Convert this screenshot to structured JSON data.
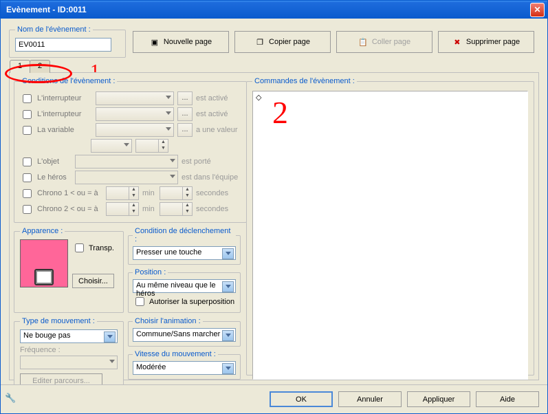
{
  "window": {
    "title": "Evènement - ID:0011"
  },
  "nameSection": {
    "legend": "Nom de l'évènement :",
    "value": "EV0011"
  },
  "topButtons": {
    "new": "Nouvelle page",
    "copy": "Copier page",
    "paste": "Coller page",
    "delete": "Supprimer page"
  },
  "tabs": [
    "1",
    "2"
  ],
  "annotations": {
    "one": "1",
    "two": "2"
  },
  "conditions": {
    "legend": "Conditions de l'évènement :",
    "switch1": {
      "label": "L'interrupteur",
      "suffix": "est activé"
    },
    "switch2": {
      "label": "L'interrupteur",
      "suffix": "est activé"
    },
    "variable": {
      "label": "La variable",
      "suffix": "a une valeur"
    },
    "item": {
      "label": "L'objet",
      "suffix": "est porté"
    },
    "hero": {
      "label": "Le héros",
      "suffix": "est dans l'équipe"
    },
    "chrono1": {
      "label": "Chrono 1 < ou = à",
      "min": "min",
      "sec": "secondes"
    },
    "chrono2": {
      "label": "Chrono 2 < ou = à",
      "min": "min",
      "sec": "secondes"
    }
  },
  "apparence": {
    "legend": "Apparence :",
    "transp": "Transp.",
    "choose": "Choisir..."
  },
  "trigger": {
    "legend": "Condition de déclenchement :",
    "value": "Presser une touche"
  },
  "position": {
    "legend": "Position :",
    "value": "Au même niveau que le héros",
    "overlap": "Autoriser la superposition"
  },
  "moveType": {
    "legend": "Type de mouvement :",
    "value": "Ne bouge pas",
    "freq": "Fréquence :",
    "edit": "Editer parcours..."
  },
  "anim": {
    "legend": "Choisir l'animation :",
    "value": "Commune/Sans marcher"
  },
  "speed": {
    "legend": "Vitesse du mouvement :",
    "value": "Modérée"
  },
  "commands": {
    "legend": "Commandes de l'évènement :",
    "first": "◇"
  },
  "footer": {
    "ok": "OK",
    "cancel": "Annuler",
    "apply": "Appliquer",
    "help": "Aide"
  }
}
